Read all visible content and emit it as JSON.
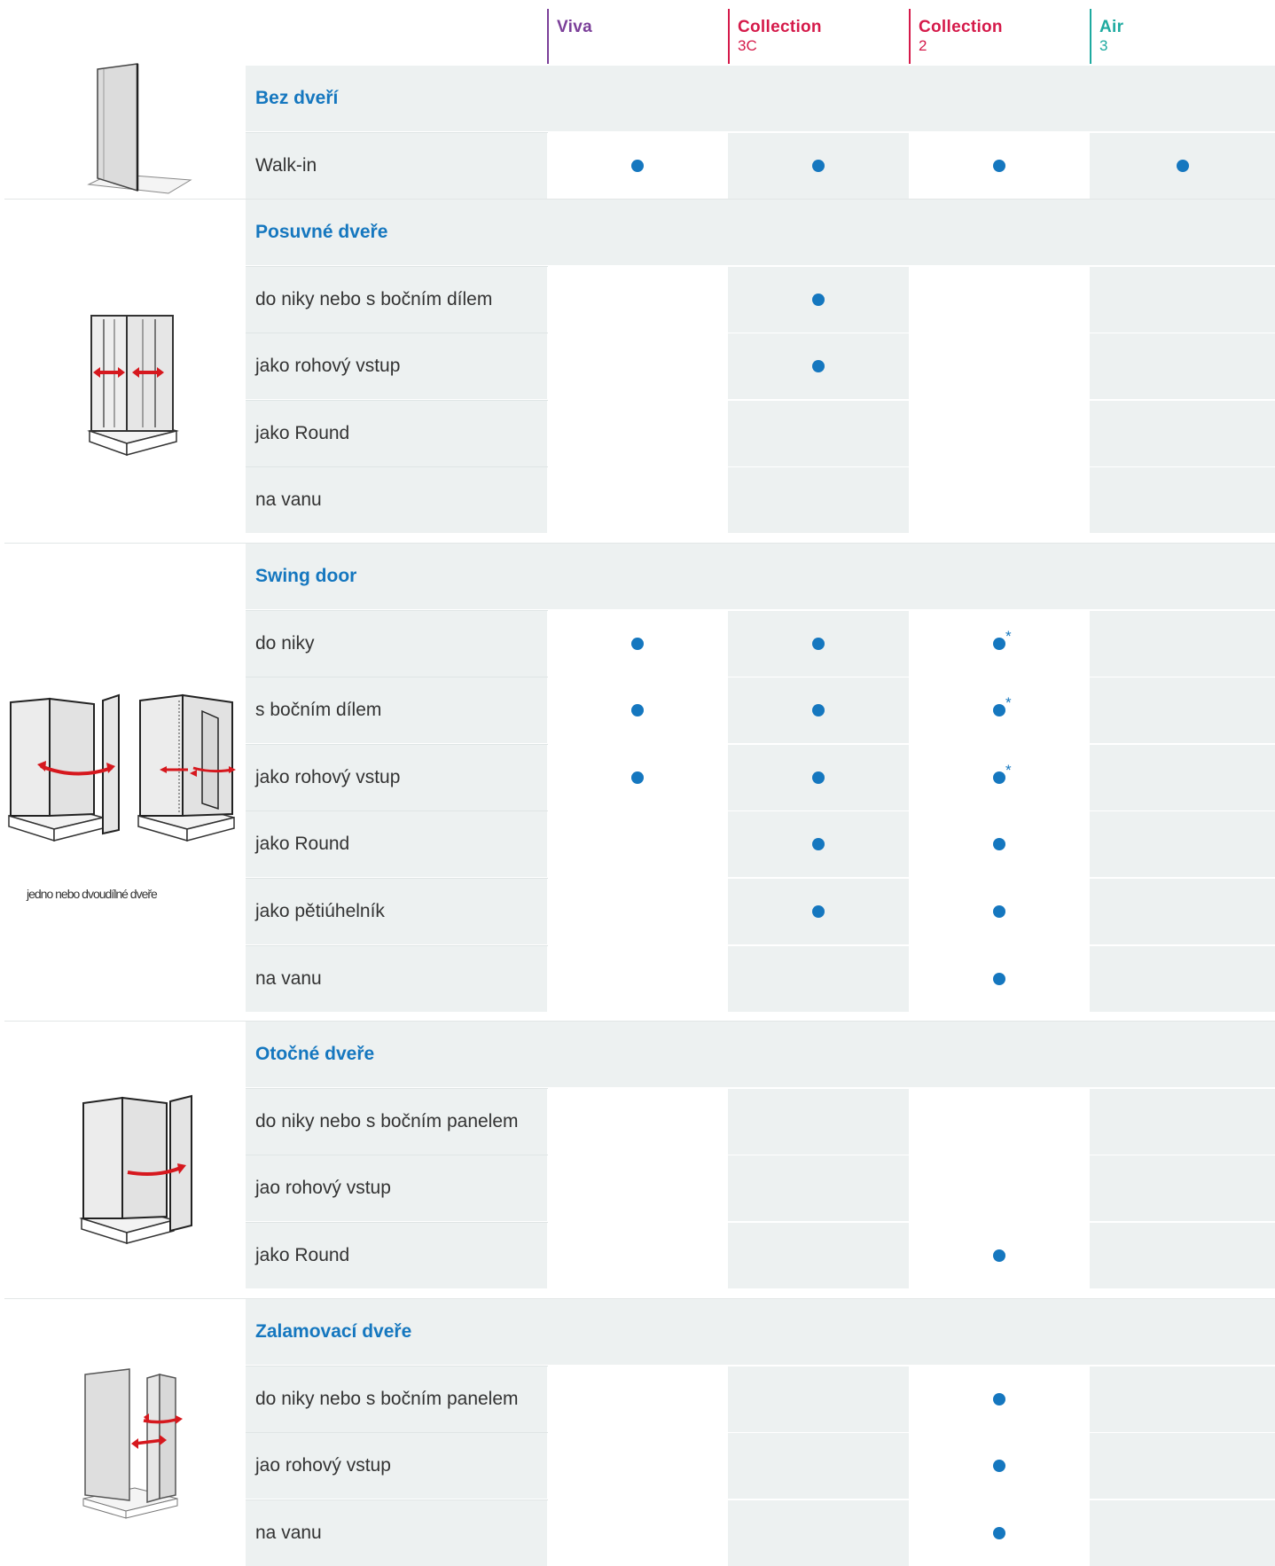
{
  "columns": [
    {
      "name": "Viva",
      "sub": "",
      "color": "#7b3f99"
    },
    {
      "name": "Collection",
      "sub": "3C",
      "color": "#d51a4a"
    },
    {
      "name": "Collection",
      "sub": "2",
      "color": "#d51a4a"
    },
    {
      "name": "Air",
      "sub": "3",
      "color": "#1eaaa0"
    }
  ],
  "accent_color": "#1577bf",
  "sections": [
    {
      "title": "Bez dveří",
      "illustration": "walk-in-panel-illustration",
      "rows": [
        {
          "label": "Walk-in",
          "marks": [
            "dot",
            "dot",
            "dot",
            "dot"
          ]
        }
      ]
    },
    {
      "title": "Posuvné dveře",
      "illustration": "sliding-door-illustration",
      "rows": [
        {
          "label": "do niky nebo s bočním dílem",
          "marks": [
            "",
            "dot",
            "",
            ""
          ]
        },
        {
          "label": "jako rohový vstup",
          "marks": [
            "",
            "dot",
            "",
            ""
          ]
        },
        {
          "label": "jako Round",
          "marks": [
            "",
            "",
            "",
            ""
          ]
        },
        {
          "label": "na vanu",
          "marks": [
            "",
            "",
            "",
            ""
          ]
        }
      ]
    },
    {
      "title": "Swing door",
      "illustration": "swing-door-illustration",
      "caption": "jedno nebo dvoudílné dveře",
      "rows": [
        {
          "label": "do niky",
          "marks": [
            "dot",
            "dot",
            "dot*",
            ""
          ]
        },
        {
          "label": "s bočním dílem",
          "marks": [
            "dot",
            "dot",
            "dot*",
            ""
          ]
        },
        {
          "label": "jako rohový vstup",
          "marks": [
            "dot",
            "dot",
            "dot*",
            ""
          ]
        },
        {
          "label": "jako Round",
          "marks": [
            "",
            "dot",
            "dot",
            ""
          ]
        },
        {
          "label": "jako pětiúhelník",
          "marks": [
            "",
            "dot",
            "dot",
            ""
          ]
        },
        {
          "label": "na vanu",
          "marks": [
            "",
            "",
            "dot",
            ""
          ]
        }
      ]
    },
    {
      "title": "Otočné dveře",
      "illustration": "pivot-door-illustration",
      "rows": [
        {
          "label": "do niky nebo s bočním panelem",
          "marks": [
            "",
            "",
            "",
            ""
          ]
        },
        {
          "label": "jao rohový vstup",
          "marks": [
            "",
            "",
            "",
            ""
          ]
        },
        {
          "label": "jako Round",
          "marks": [
            "",
            "",
            "dot",
            ""
          ]
        }
      ]
    },
    {
      "title": "Zalamovací dveře",
      "illustration": "folding-door-illustration",
      "rows": [
        {
          "label": "do niky nebo s bočním panelem",
          "marks": [
            "",
            "",
            "dot",
            ""
          ]
        },
        {
          "label": "jao rohový vstup",
          "marks": [
            "",
            "",
            "dot",
            ""
          ]
        },
        {
          "label": "na vanu",
          "marks": [
            "",
            "",
            "dot",
            ""
          ]
        }
      ]
    }
  ]
}
